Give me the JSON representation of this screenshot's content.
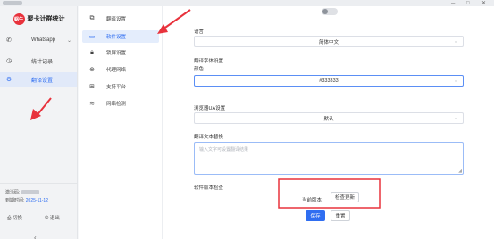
{
  "brand": {
    "logo_text": "蜗牛",
    "name": "聚卡计群统计"
  },
  "nav": [
    {
      "icon": "whatsapp-icon",
      "label": "Whatsapp",
      "has_chevron": true,
      "active": false
    },
    {
      "icon": "clock-icon",
      "label": "统计记录",
      "active": false
    },
    {
      "icon": "gear-icon",
      "label": "翻译设置",
      "active": true
    }
  ],
  "account": {
    "code_label": "激活码:",
    "expire_label": "到期时间:",
    "expire_value": "2025-11-12",
    "actions": [
      "切换",
      "退出"
    ]
  },
  "submenu": [
    {
      "icon": "translate-icon",
      "label": "翻译设置",
      "active": false
    },
    {
      "icon": "monitor-icon",
      "label": "软件设置",
      "active": true
    },
    {
      "icon": "lock-icon",
      "label": "锁屏设置",
      "active": false
    },
    {
      "icon": "globe-icon",
      "label": "代理网络",
      "active": false
    },
    {
      "icon": "grid-icon",
      "label": "支持平台",
      "active": false
    },
    {
      "icon": "wifi-icon",
      "label": "网络检测",
      "active": false
    }
  ],
  "settings": {
    "language_label": "语言",
    "language_value": "简体中文",
    "font_section_label": "翻译字体设置",
    "color_label": "颜色",
    "color_value": "#333333",
    "ua_label": "浏览器UA设置",
    "ua_value": "默认",
    "text_label": "翻译文本替换",
    "text_placeholder": "输入文字可设置翻译结果",
    "version_section_label": "软件版本检查",
    "current_version_label": "当前版本:",
    "check_update_label": "检查更新",
    "save_label": "保存",
    "reset_label": "重置"
  },
  "annotation_color": "#e8323c"
}
